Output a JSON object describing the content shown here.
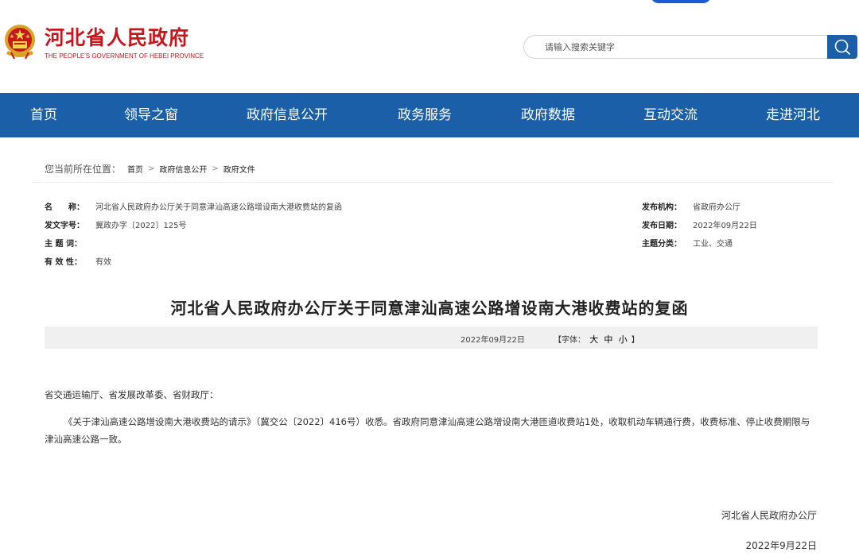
{
  "header": {
    "site_title": "河北省人民政府",
    "site_subtitle": "THE PEOPLE'S GOVERNMENT OF HEBEI PROVINCE"
  },
  "search": {
    "placeholder": "请输入搜索关键字"
  },
  "nav": {
    "items": [
      "首页",
      "领导之窗",
      "政府信息公开",
      "政务服务",
      "政府数据",
      "互动交流",
      "走进河北"
    ]
  },
  "breadcrumb": {
    "label": "您当前所在位置：",
    "items": [
      "首页",
      "政府信息公开",
      "政府文件"
    ],
    "separator": ">"
  },
  "meta": {
    "name_label": "名　　称：",
    "name_value": "河北省人民政府办公厅关于同意津汕高速公路增设南大港收费站的复函",
    "doc_no_label": "发文字号：",
    "doc_no_value": "冀政办字〔2022〕125号",
    "subject_label": "主 题 词：",
    "subject_value": "",
    "validity_label": "有 效 性：",
    "validity_value": "有效",
    "publisher_label": "发布机构：",
    "publisher_value": "省政府办公厅",
    "pub_date_label": "发布日期：",
    "pub_date_value": "2022年09月22日",
    "category_label": "主题分类：",
    "category_value": "工业、交通"
  },
  "document": {
    "title": "河北省人民政府办公厅关于同意津汕高速公路增设南大港收费站的复函",
    "date": "2022年09月22日",
    "font_size_prefix": "【字体：",
    "font_large": "大",
    "font_medium": "中",
    "font_small": "小",
    "font_size_suffix": "】",
    "salutation": "省交通运输厅、省发展改革委、省财政厅：",
    "paragraph": "《关于津汕高速公路增设南大港收费站的请示》（冀交公〔2022〕416号）收悉。省政府同意津汕高速公路增设南大港匝道收费站1处，收取机动车辆通行费，收费标准、停止收费期限与津汕高速公路一致。",
    "signoff_org": "河北省人民政府办公厅",
    "signoff_date": "2022年9月22日"
  },
  "colors": {
    "brand_red": "#c8161d",
    "nav_blue": "#1a5fa8"
  },
  "icons": {
    "emblem": "national-emblem-icon",
    "search": "search-icon"
  }
}
